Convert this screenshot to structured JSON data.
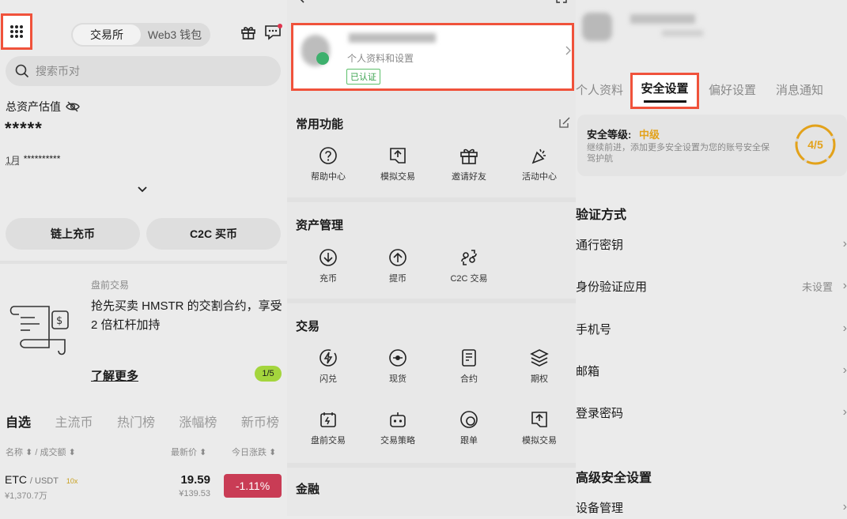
{
  "left": {
    "segment": [
      "交易所",
      "Web3 钱包"
    ],
    "search_placeholder": "搜索币对",
    "asset_label": "总资产估值",
    "asset_masked": "*****",
    "month_label": "1月",
    "month_masked": "**********",
    "buttons": [
      "链上充币",
      "C2C 买币"
    ],
    "promo": {
      "tag": "盘前交易",
      "text": "抢先买卖 HMSTR 的交割合约，享受 2 倍杠杆加持",
      "link": "了解更多",
      "page": "1/5"
    },
    "tabs": [
      "自选",
      "主流币",
      "热门榜",
      "涨幅榜",
      "新币榜"
    ],
    "columns": {
      "name": "名称 ⬍ / 成交额 ⬍",
      "price": "最新价 ⬍",
      "change": "今日涨跌 ⬍"
    },
    "row": {
      "symbol": "ETC",
      "quote": "/ USDT",
      "leverage": "10x",
      "volume": "¥1,370.7万",
      "price": "19.59",
      "price_cny": "¥139.53",
      "change": "-1.11%"
    },
    "colors": {
      "accent": "#f0523b",
      "change_bg": "#c93c55",
      "badge": "#a4d53d"
    }
  },
  "middle": {
    "profile": {
      "subtitle": "个人资料和设置",
      "verified": "已认证"
    },
    "sections": [
      {
        "title": "常用功能",
        "items": [
          {
            "label": "帮助中心",
            "icon": "help-icon"
          },
          {
            "label": "模拟交易",
            "icon": "demo-trade-icon"
          },
          {
            "label": "邀请好友",
            "icon": "gift-icon"
          },
          {
            "label": "活动中心",
            "icon": "party-icon"
          }
        ]
      },
      {
        "title": "资产管理",
        "items": [
          {
            "label": "充币",
            "icon": "deposit-icon"
          },
          {
            "label": "提币",
            "icon": "withdraw-icon"
          },
          {
            "label": "C2C 交易",
            "icon": "c2c-icon"
          }
        ]
      },
      {
        "title": "交易",
        "items": [
          {
            "label": "闪兑",
            "icon": "flash-convert-icon"
          },
          {
            "label": "现货",
            "icon": "spot-icon"
          },
          {
            "label": "合约",
            "icon": "futures-icon"
          },
          {
            "label": "期权",
            "icon": "options-icon"
          },
          {
            "label": "盘前交易",
            "icon": "premarket-icon"
          },
          {
            "label": "交易策略",
            "icon": "bot-icon"
          },
          {
            "label": "跟单",
            "icon": "copy-trade-icon"
          },
          {
            "label": "模拟交易",
            "icon": "demo-trade-icon"
          }
        ]
      },
      {
        "title": "金融",
        "items": []
      }
    ]
  },
  "right": {
    "tabs": [
      "个人资料",
      "安全设置",
      "偏好设置",
      "消息通知"
    ],
    "level": {
      "label": "安全等级:",
      "value": "中级",
      "desc": "继续前进，添加更多安全设置为您的账号安全保驾护航",
      "score": "4/5",
      "progress": 0.8
    },
    "verify_title": "验证方式",
    "verify_rows": [
      {
        "label": "通行密钥",
        "value": ""
      },
      {
        "label": "身份验证应用",
        "value": "未设置"
      },
      {
        "label": "手机号",
        "value": ""
      },
      {
        "label": "邮箱",
        "value": ""
      },
      {
        "label": "登录密码",
        "value": ""
      }
    ],
    "advanced_title": "高级安全设置",
    "advanced_rows": [
      {
        "label": "设备管理"
      }
    ]
  }
}
